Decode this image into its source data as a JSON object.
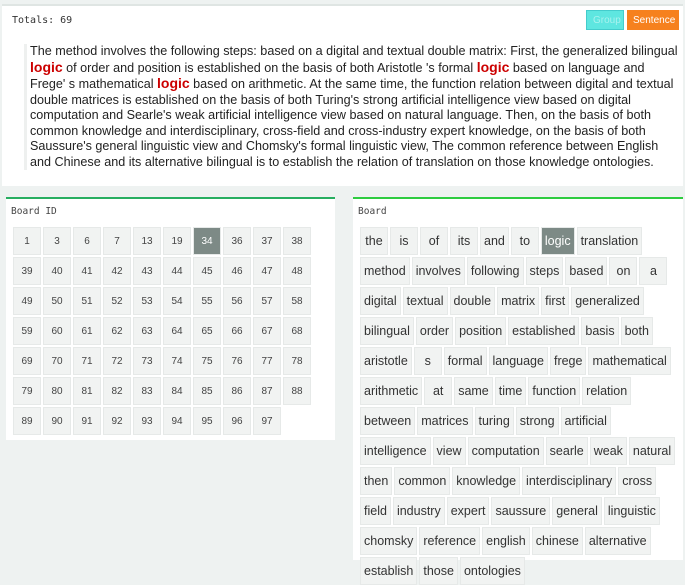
{
  "header": {
    "totals": "Totals: 69",
    "group_label": "Group",
    "sentence_label": "Sentence"
  },
  "sentence": {
    "parts": [
      "The method involves the following steps: based on a digital and textual double matrix: First, the generalized bilingual ",
      "logic",
      " of order and position is established on the basis of both Aristotle 's formal ",
      "logic",
      " based on language and Frege' s mathematical ",
      "logic",
      " based on arithmetic. At the same time, the function relation between digital and textual double matrices is established on the basis of both Turing's strong artificial intelligence view based on digital computation and Searle's weak artificial intelligence view based on natural language. Then, on the basis of both common knowledge and interdisciplinary, cross-field and cross-industry expert knowledge, on the basis of both Saussure's general linguistic view and Chomsky's formal linguistic view, The common reference between English and Chinese and its alternative bilingual is to establish the relation of translation on those knowledge ontologies."
    ],
    "highlight_color": "#cc0000"
  },
  "board_id": {
    "title": "Board ID",
    "selected": "34",
    "ids": [
      "1",
      "3",
      "6",
      "7",
      "13",
      "19",
      "34",
      "36",
      "37",
      "38",
      "39",
      "40",
      "41",
      "42",
      "43",
      "44",
      "45",
      "46",
      "47",
      "48",
      "49",
      "50",
      "51",
      "52",
      "53",
      "54",
      "55",
      "56",
      "57",
      "58",
      "59",
      "60",
      "61",
      "62",
      "63",
      "64",
      "65",
      "66",
      "67",
      "68",
      "69",
      "70",
      "71",
      "72",
      "73",
      "74",
      "75",
      "76",
      "77",
      "78",
      "79",
      "80",
      "81",
      "82",
      "83",
      "84",
      "85",
      "86",
      "87",
      "88",
      "89",
      "90",
      "91",
      "92",
      "93",
      "94",
      "95",
      "96",
      "97"
    ]
  },
  "board": {
    "title": "Board",
    "selected": "logic",
    "words": [
      "the",
      "is",
      "of",
      "its",
      "and",
      "to",
      "logic",
      "translation",
      "method",
      "involves",
      "following",
      "steps",
      "based",
      "on",
      "a",
      "digital",
      "textual",
      "double",
      "matrix",
      "first",
      "generalized",
      "bilingual",
      "order",
      "position",
      "established",
      "basis",
      "both",
      "aristotle",
      "s",
      "formal",
      "language",
      "frege",
      "mathematical",
      "arithmetic",
      "at",
      "same",
      "time",
      "function",
      "relation",
      "between",
      "matrices",
      "turing",
      "strong",
      "artificial",
      "intelligence",
      "view",
      "computation",
      "searle",
      "weak",
      "natural",
      "then",
      "common",
      "knowledge",
      "interdisciplinary",
      "cross",
      "field",
      "industry",
      "expert",
      "saussure",
      "general",
      "linguistic",
      "chomsky",
      "reference",
      "english",
      "chinese",
      "alternative",
      "establish",
      "those",
      "ontologies"
    ]
  },
  "colors": {
    "accent_green": "#27ae60",
    "group_button": "#5ee6e0",
    "sentence_button": "#f6811e",
    "selected": "#7d8a86"
  }
}
